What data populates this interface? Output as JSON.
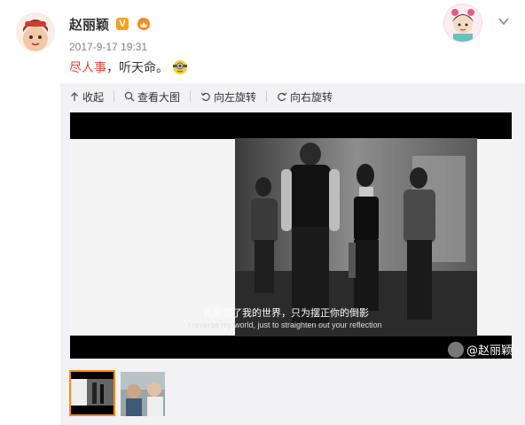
{
  "post": {
    "username": "赵丽颖",
    "verified_badge": "V",
    "timestamp": "2017-9-17 19:31",
    "text_highlight": "尽人事",
    "text_rest": "，听天命。",
    "emoji": "minion-emoji"
  },
  "toolbar": {
    "collect": "收起",
    "view_large": "查看大图",
    "rotate_left": "向左旋转",
    "rotate_right": "向右旋转"
  },
  "media": {
    "subtitle_zh": "我颠倒了我的世界，只为摆正你的倒影",
    "subtitle_en": "I reverse my world, just to straighten out your reflection",
    "watermark": "@赵丽颖"
  },
  "thumbnails": [
    {
      "selected": true
    },
    {
      "selected": false
    }
  ],
  "colors": {
    "highlight": "#e2473b",
    "badge": "#f7a21b",
    "thumb_border": "#f68b1f"
  }
}
